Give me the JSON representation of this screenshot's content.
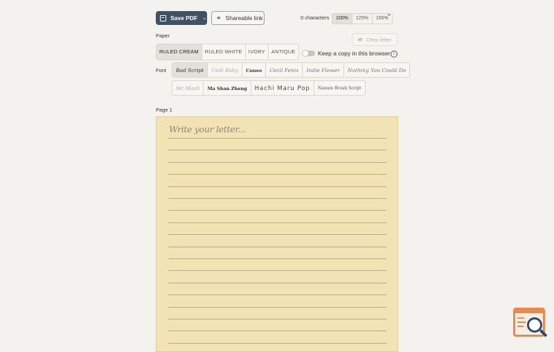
{
  "toolbar": {
    "save_label": "Save PDF",
    "share_label": "Shareable link",
    "char_count": "0 characters",
    "zoom_options": [
      "100%",
      "125%",
      "150%"
    ]
  },
  "paper": {
    "label": "Paper",
    "options": [
      "RULED CREAM",
      "RULED WHITE",
      "IVORY",
      "ANTIQUE"
    ],
    "selected": "RULED CREAM"
  },
  "clear_label": "Clear letter",
  "keep_copy_label": "Keep a copy in this browser",
  "font": {
    "label": "Font",
    "row1": [
      "Bad Script",
      "Cedi Baby",
      "Cuneo",
      "Cecil Fenix",
      "Indie Flower",
      "Nothing You Could Do"
    ],
    "row2": [
      "Mr Mash",
      "Ma Shan Zheng",
      "Hachi Maru Pop",
      "Nanum Brush Script"
    ],
    "selected": "Bad Script"
  },
  "page": {
    "label": "Page 1",
    "placeholder": "Write your letter..."
  },
  "colors": {
    "primary": "#3f5163",
    "paper": "#f2e3b4",
    "logo_orange": "#e9894a",
    "logo_blue": "#2b4a6e"
  }
}
